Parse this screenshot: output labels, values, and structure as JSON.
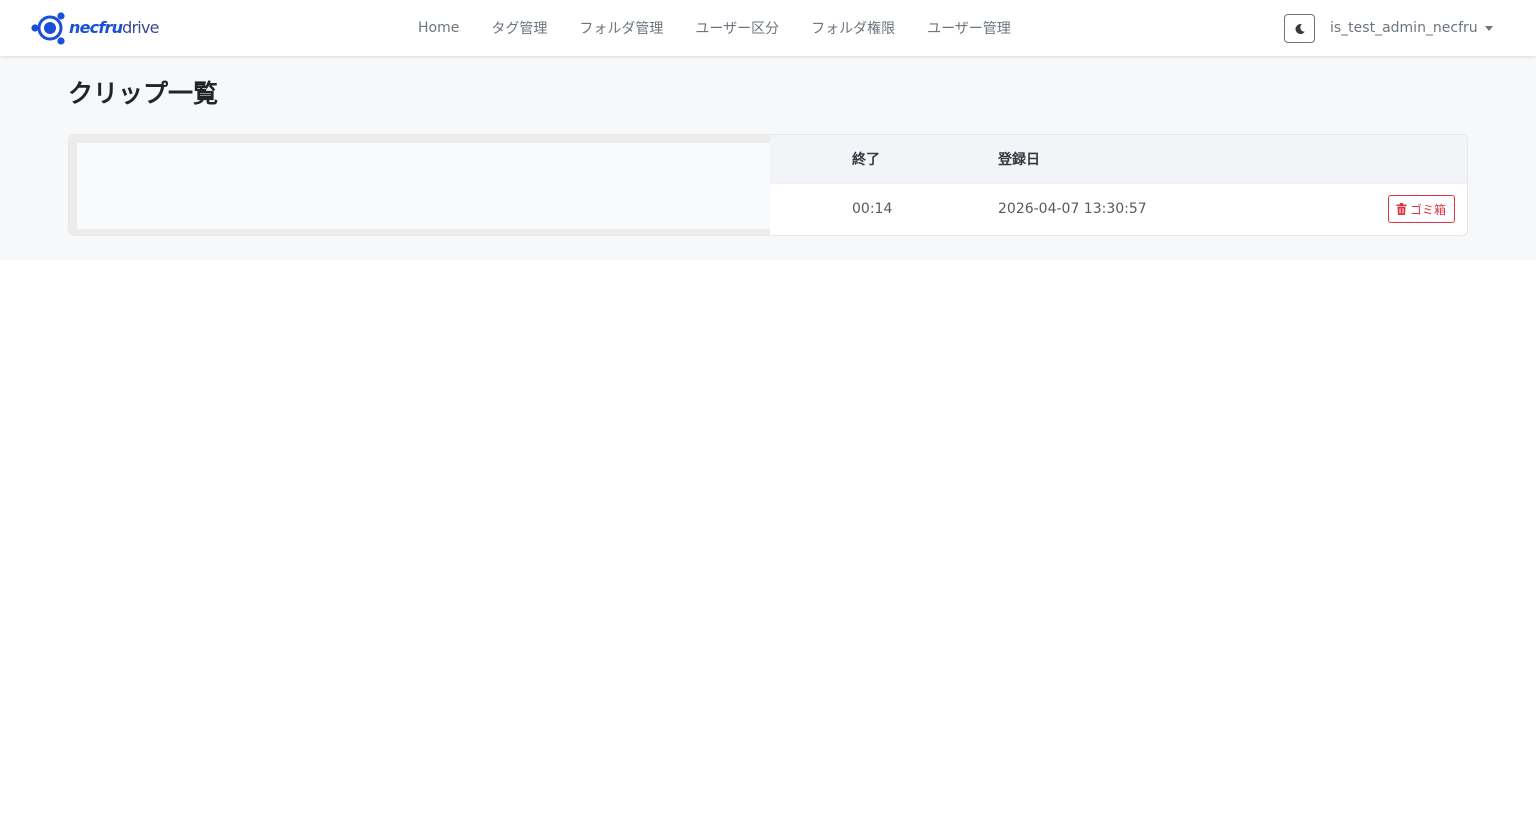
{
  "brand": {
    "name_bold": "necfru",
    "name_light": "drive"
  },
  "nav": {
    "items": [
      {
        "label": "Home"
      },
      {
        "label": "タグ管理"
      },
      {
        "label": "フォルダ管理"
      },
      {
        "label": "ユーザー区分"
      },
      {
        "label": "フォルダ権限"
      },
      {
        "label": "ユーザー管理"
      }
    ]
  },
  "header": {
    "theme_toggle_icon": "moon-icon",
    "username": "is_test_admin_necfru"
  },
  "page": {
    "title": "クリップ一覧"
  },
  "clip_table": {
    "columns": {
      "end": "終了",
      "registered": "登録日"
    },
    "rows": [
      {
        "end": "00:14",
        "registered": "2026-04-07 13:30:57",
        "action_label": "ゴミ箱",
        "action_icon": "trash-icon"
      }
    ]
  },
  "colors": {
    "brand": "#1a4fd8",
    "danger": "#dc3545",
    "text_muted": "#6c757d",
    "page_band": "#f7f8fa"
  }
}
